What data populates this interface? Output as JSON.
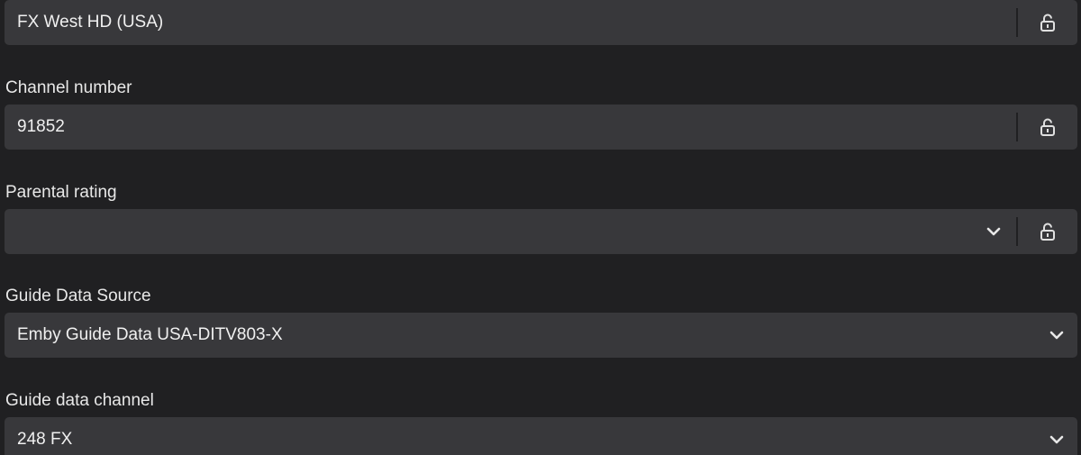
{
  "fields": {
    "name": {
      "value": "FX West HD (USA)"
    },
    "channel_number": {
      "label": "Channel number",
      "value": "91852"
    },
    "parental_rating": {
      "label": "Parental rating",
      "value": ""
    },
    "guide_source": {
      "label": "Guide Data Source",
      "value": "Emby Guide Data USA-DITV803-X"
    },
    "guide_channel": {
      "label": "Guide data channel",
      "value": "248 FX"
    }
  },
  "icons": {
    "lock": "unlock-icon",
    "dropdown": "chevron-down-icon"
  },
  "colors": {
    "background": "#202022",
    "field": "#38383b",
    "text": "#f0f0f0"
  }
}
